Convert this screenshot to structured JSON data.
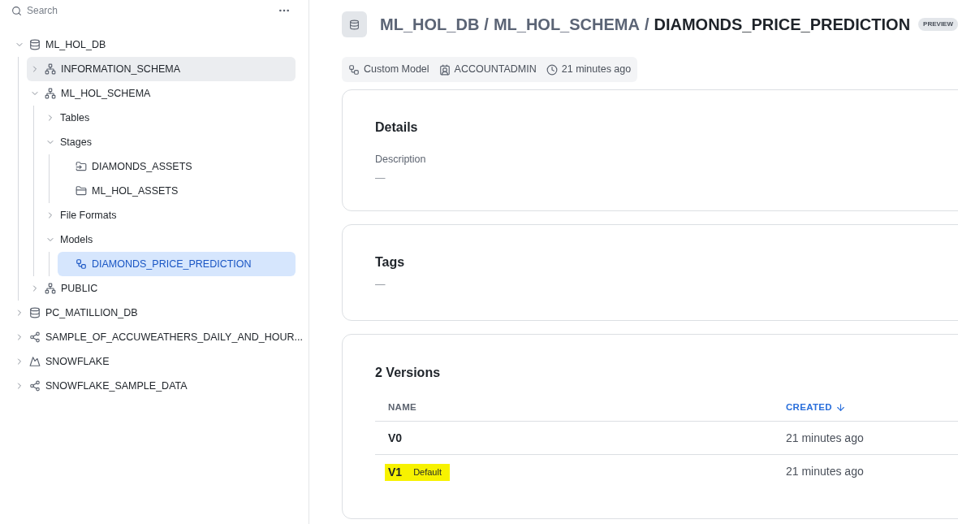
{
  "sidebar": {
    "search": {
      "placeholder": "Search"
    },
    "tree": [
      {
        "label": "ML_HOL_DB",
        "kind": "database",
        "expanded": true,
        "selected": false,
        "hovered": false,
        "children": [
          {
            "label": "INFORMATION_SCHEMA",
            "kind": "schema",
            "expanded": false,
            "selected": false,
            "hovered": true
          },
          {
            "label": "ML_HOL_SCHEMA",
            "kind": "schema",
            "expanded": true,
            "selected": false,
            "hovered": false,
            "children": [
              {
                "label": "Tables",
                "expanded": false,
                "selected": false,
                "hovered": false
              },
              {
                "label": "Stages",
                "expanded": true,
                "selected": false,
                "hovered": false,
                "children": [
                  {
                    "label": "DIAMONDS_ASSETS",
                    "kind": "external-stage",
                    "selected": false,
                    "hovered": false
                  },
                  {
                    "label": "ML_HOL_ASSETS",
                    "kind": "internal-stage",
                    "selected": false,
                    "hovered": false
                  }
                ]
              },
              {
                "label": "File Formats",
                "expanded": false,
                "selected": false,
                "hovered": false
              },
              {
                "label": "Models",
                "expanded": true,
                "selected": false,
                "hovered": false,
                "children": [
                  {
                    "label": "DIAMONDS_PRICE_PREDICTION",
                    "kind": "model",
                    "selected": true,
                    "hovered": false
                  }
                ]
              }
            ]
          },
          {
            "label": "PUBLIC",
            "kind": "schema",
            "expanded": false,
            "selected": false,
            "hovered": false
          }
        ]
      },
      {
        "label": "PC_MATILLION_DB",
        "kind": "database",
        "expanded": false,
        "selected": false,
        "hovered": false
      },
      {
        "label": "SAMPLE_OF_ACCUWEATHERS_DAILY_AND_HOUR...",
        "kind": "shared-database",
        "expanded": false,
        "selected": false,
        "hovered": false
      },
      {
        "label": "SNOWFLAKE",
        "kind": "app",
        "expanded": false,
        "selected": false,
        "hovered": false
      },
      {
        "label": "SNOWFLAKE_SAMPLE_DATA",
        "kind": "shared-database",
        "expanded": false,
        "selected": false,
        "hovered": false
      }
    ]
  },
  "header": {
    "breadcrumb": [
      "ML_HOL_DB",
      "ML_HOL_SCHEMA"
    ],
    "separator": "/",
    "title": "DIAMONDS_PRICE_PREDICTION",
    "badge": "PREVIEW",
    "meta": [
      {
        "kind": "model",
        "text": "Custom Model"
      },
      {
        "kind": "owner",
        "text": "ACCOUNTADMIN"
      },
      {
        "kind": "time",
        "text": "21 minutes ago"
      }
    ]
  },
  "details": {
    "title": "Details",
    "description_label": "Description",
    "description_value": "—"
  },
  "tags": {
    "title": "Tags",
    "value": "—"
  },
  "versions": {
    "title": "2 Versions",
    "columns": [
      {
        "label": "NAME",
        "sorted": false
      },
      {
        "label": "CREATED",
        "sorted": true
      }
    ],
    "rows": [
      {
        "name": "V0",
        "created": "21 minutes ago",
        "highlighted": false
      },
      {
        "name": "V1",
        "badge": "Default",
        "created": "21 minutes ago",
        "highlighted": true
      }
    ]
  }
}
